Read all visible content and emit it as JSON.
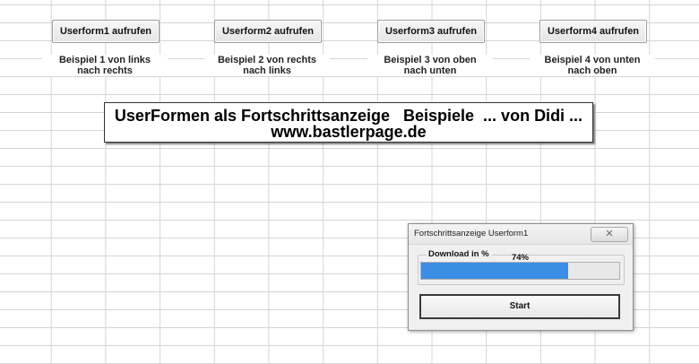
{
  "sheet": {
    "buttons": [
      {
        "label": "Userform1 aufrufen"
      },
      {
        "label": "Userform2 aufrufen"
      },
      {
        "label": "Userform3 aufrufen"
      },
      {
        "label": "Userform4 aufrufen"
      }
    ],
    "descriptions": [
      {
        "text": "Beispiel 1 von links\nnach rechts"
      },
      {
        "text": "Beispiel 2 von rechts\nnach links"
      },
      {
        "text": "Beispiel 3 von oben\nnach unten"
      },
      {
        "text": "Beispiel 4 von unten\nnach oben"
      }
    ],
    "banner": {
      "line1": "UserFormen als Fortschrittsanzeige   Beispiele  ... von Didi ...",
      "line2": "www.bastlerpage.de"
    }
  },
  "dialog": {
    "title": "Fortschrittsanzeige Userform1",
    "close_icon": "close-x-icon",
    "close_glyph": "✕",
    "frame_label": "Download in %",
    "progress": {
      "percent": 74,
      "label": "74%",
      "fill_color": "#3c8ee4"
    },
    "start_label": "Start"
  }
}
